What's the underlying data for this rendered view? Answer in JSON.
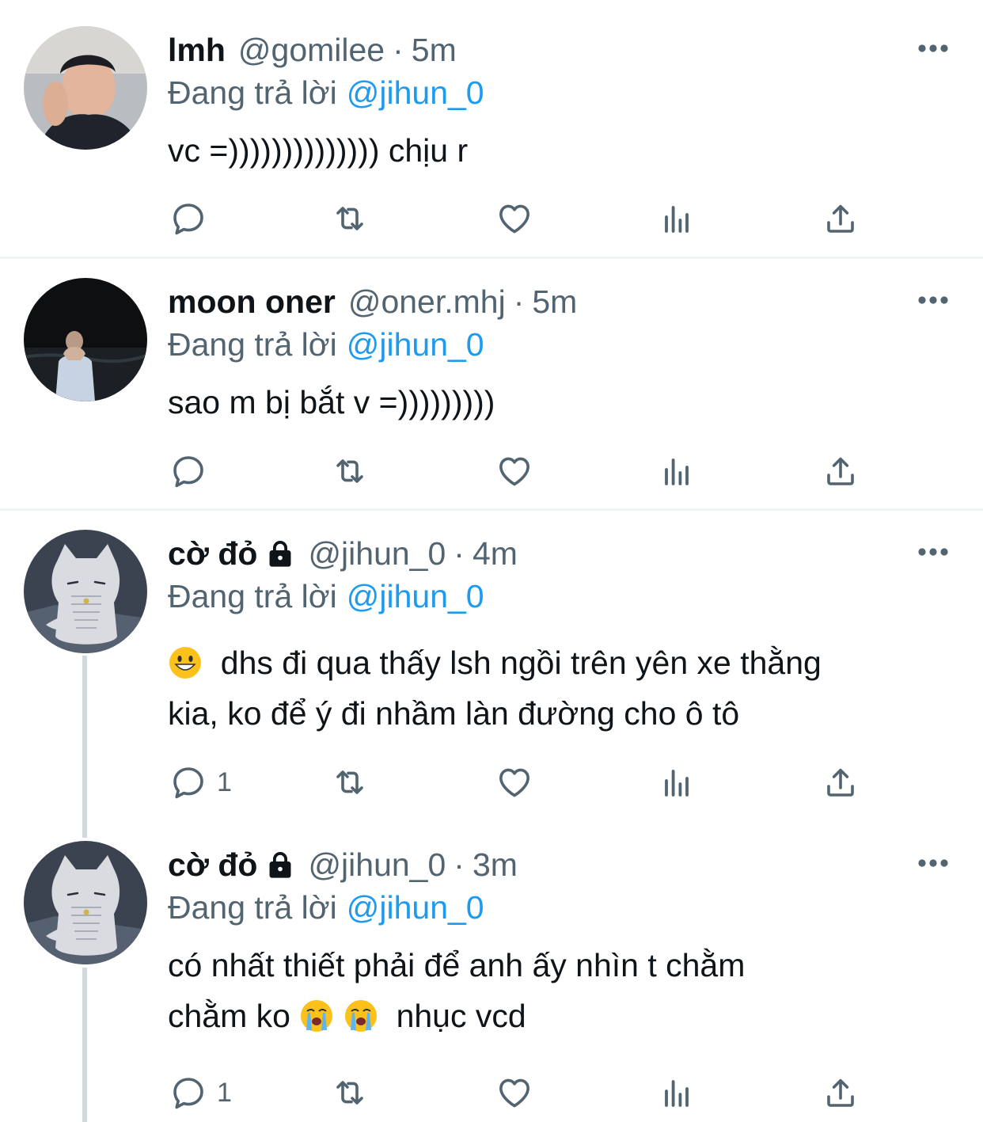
{
  "tweets": [
    {
      "name": "lmh",
      "handle": "@gomilee",
      "separator": "·",
      "time": "5m",
      "replying_prefix": "Đang trả lời",
      "replying_to": "@jihun_0",
      "text": "vc =)))))))))))))) chịu r",
      "reply_count": "",
      "locked": false,
      "avatar": "person-photo-icon"
    },
    {
      "name": "moon oner",
      "handle": "@oner.mhj",
      "separator": "·",
      "time": "5m",
      "replying_prefix": "Đang trả lời",
      "replying_to": "@jihun_0",
      "text": "sao m bị bắt v =)))))))))",
      "reply_count": "",
      "locked": false,
      "avatar": "night-photo-icon"
    },
    {
      "name": "cờ đỏ",
      "handle": "@jihun_0",
      "separator": "·",
      "time": "4m",
      "replying_prefix": "Đang trả lời",
      "replying_to": "@jihun_0",
      "text_line1": "dhs đi qua thấy lsh ngồi trên yên xe thằng",
      "text_line2": "kia, ko để ý đi nhầm làn đường cho ô tô",
      "reply_count": "1",
      "locked": true,
      "avatar": "cat-illustration-icon"
    },
    {
      "name": "cờ đỏ",
      "handle": "@jihun_0",
      "separator": "·",
      "time": "3m",
      "replying_prefix": "Đang trả lời",
      "replying_to": "@jihun_0",
      "text_line1": "có nhất thiết phải để anh ấy nhìn t chằm",
      "text_line2a": "chằm ko",
      "text_line2b": "nhục vcd",
      "reply_count": "1",
      "locked": true,
      "avatar": "cat-illustration-icon"
    }
  ],
  "icons": {
    "reply": "reply-bubble-icon",
    "retweet": "retweet-icon",
    "like": "heart-icon",
    "views": "analytics-bars-icon",
    "share": "share-upload-icon",
    "more": "more-dots-icon",
    "lock": "lock-icon"
  },
  "colors": {
    "accent": "#1d9bf0",
    "secondary_text": "#536471",
    "primary_text": "#0f1419",
    "divider": "#eff3f4",
    "thread_line": "#cfd9de"
  }
}
